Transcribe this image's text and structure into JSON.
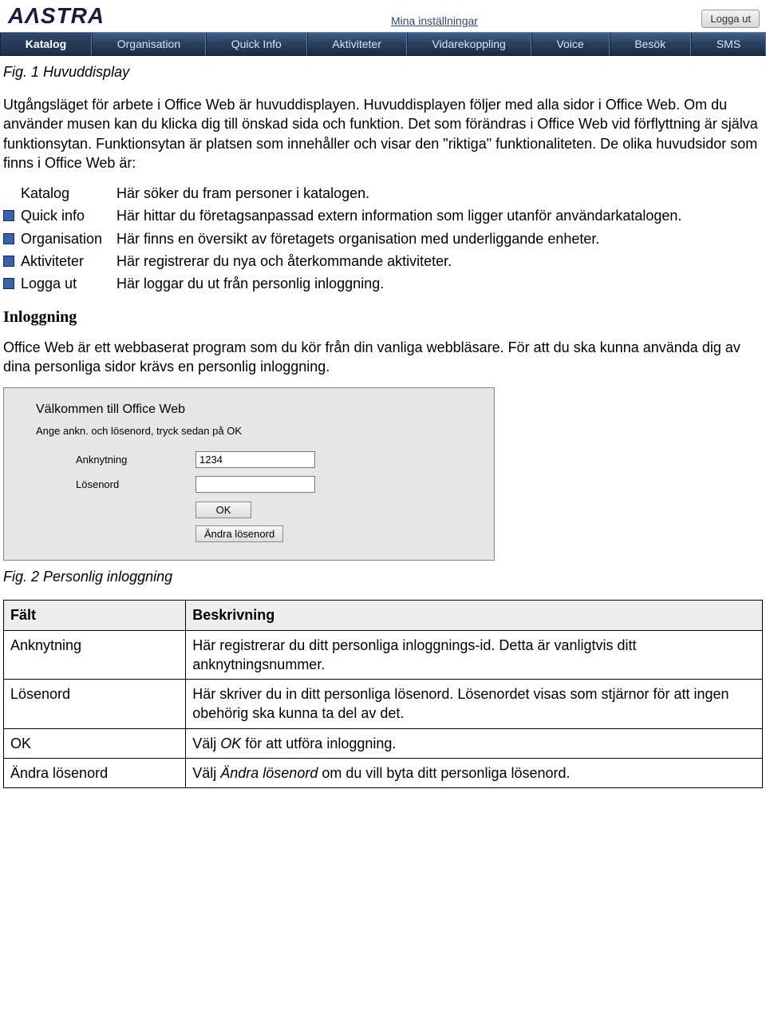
{
  "topbar": {
    "logo_text": "AΛSTRA",
    "settings_link": "Mina inställningar",
    "logout_label": "Logga ut"
  },
  "nav": {
    "items": [
      "Katalog",
      "Organisation",
      "Quick Info",
      "Aktiviteter",
      "Vidarekoppling",
      "Voice",
      "Besök",
      "SMS"
    ]
  },
  "fig1": "Fig. 1 Huvuddisplay",
  "para1": "Utgångsläget för arbete i Office Web är huvuddisplayen. Huvuddisplayen följer med alla sidor i Office Web. Om du använder musen kan du klicka dig till önskad sida och funktion. Det som förändras i Office Web vid förflyttning är själva funktionsytan. Funktionsytan är platsen som innehåller och visar den \"riktiga\" funktionaliteten. De olika huvudsidor som finns i Office Web är:",
  "defs": [
    {
      "bullet": false,
      "term": "Katalog",
      "desc": "Här söker du fram personer i katalogen."
    },
    {
      "bullet": true,
      "term": "Quick info",
      "desc": "Här hittar du företagsanpassad extern information som ligger utanför användarkatalogen."
    },
    {
      "bullet": true,
      "term": "Organisation",
      "desc": "Här finns en översikt av företagets organisation med underliggande enheter."
    },
    {
      "bullet": true,
      "term": "Aktiviteter",
      "desc": "Här registrerar du nya och återkommande aktiviteter."
    },
    {
      "bullet": true,
      "term": "Logga ut",
      "desc": "Här loggar du ut från personlig inloggning."
    }
  ],
  "section2": "Inloggning",
  "para2": "Office Web är ett webbaserat program som du kör från din vanliga webbläsare. För att du ska kunna använda dig av dina personliga sidor krävs en personlig inloggning.",
  "login": {
    "title": "Välkommen till Office Web",
    "hint": "Ange ankn. och lösenord, tryck sedan på OK",
    "ext_label": "Anknytning",
    "ext_value": "1234",
    "pwd_label": "Lösenord",
    "pwd_value": "",
    "ok_label": "OK",
    "change_label": "Ändra lösenord"
  },
  "fig2": "Fig. 2 Personlig inloggning",
  "table": {
    "head_field": "Fält",
    "head_desc": "Beskrivning",
    "rows": [
      {
        "field": "Anknytning",
        "desc": "Här registrerar du ditt personliga inloggnings-id. Detta är vanligtvis ditt anknytningsnummer."
      },
      {
        "field": "Lösenord",
        "desc": "Här skriver du in ditt personliga lösenord. Lösenordet visas som stjärnor för att ingen obehörig ska kunna ta del av det."
      },
      {
        "field": "OK",
        "desc_pre": "Välj ",
        "desc_it": "OK",
        "desc_post": " för att utföra inloggning."
      },
      {
        "field": "Ändra lösenord",
        "desc_pre": "Välj ",
        "desc_it": "Ändra lösenord",
        "desc_post": " om du vill byta ditt personliga lösenord."
      }
    ]
  }
}
